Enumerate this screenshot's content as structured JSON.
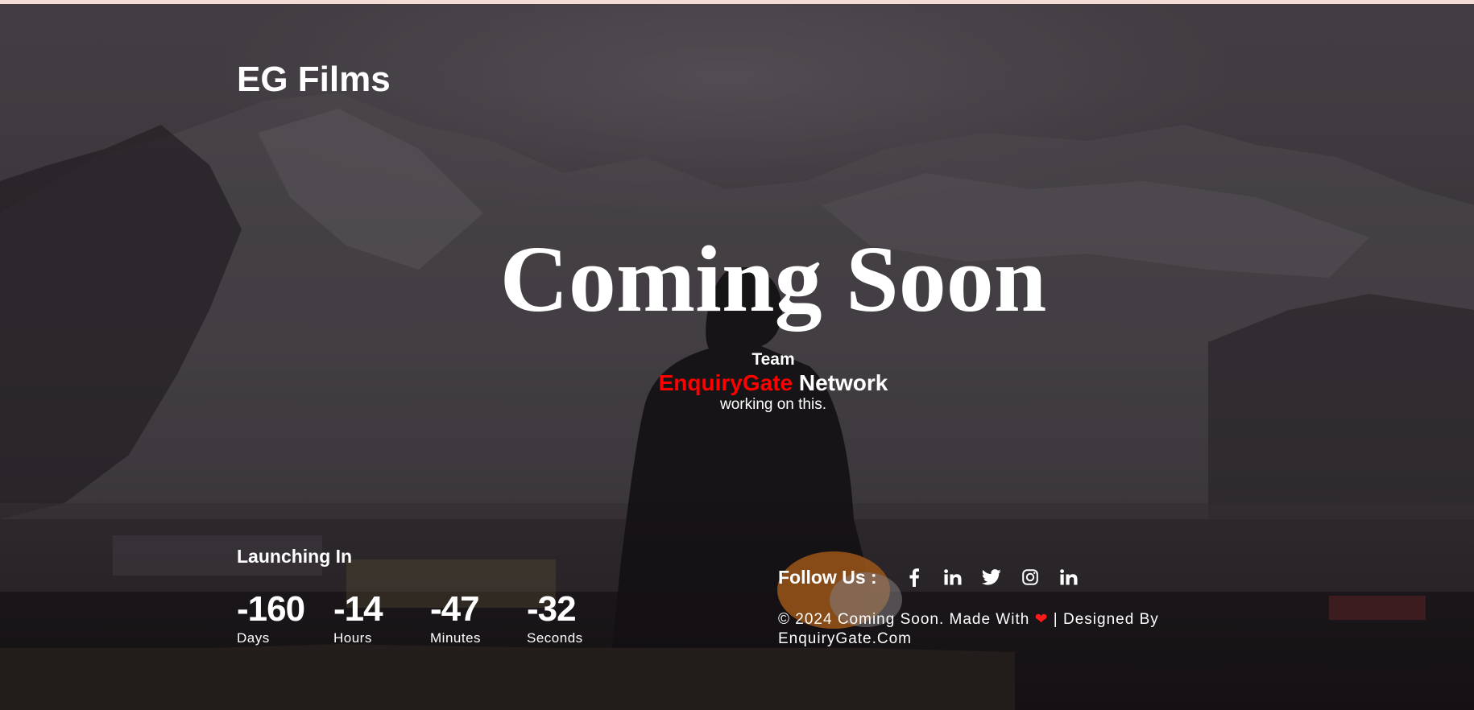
{
  "brand": {
    "logo_text": "EG Films"
  },
  "hero": {
    "title": "Coming Soon",
    "team_label": "Team",
    "team_brand": "EnquiryGate",
    "team_network": "Network",
    "team_note": "working on this."
  },
  "countdown": {
    "label": "Launching In",
    "items": [
      {
        "value": "-160",
        "unit": "Days"
      },
      {
        "value": "-14",
        "unit": "Hours"
      },
      {
        "value": "-47",
        "unit": "Minutes"
      },
      {
        "value": "-32",
        "unit": "Seconds"
      }
    ]
  },
  "footer": {
    "follow_label": "Follow Us :",
    "social_links": [
      {
        "name": "facebook",
        "icon": "facebook-icon"
      },
      {
        "name": "linkedin",
        "icon": "linkedin-icon"
      },
      {
        "name": "twitter",
        "icon": "twitter-icon"
      },
      {
        "name": "instagram",
        "icon": "instagram-icon"
      },
      {
        "name": "linkedin",
        "icon": "linkedin-icon"
      }
    ],
    "copyright_prefix": "© 2024 Coming Soon. Made With",
    "heart": "❤",
    "copyright_suffix": "| Designed By",
    "designer": "EnquiryGate.Com"
  },
  "colors": {
    "accent_red": "#ff0000",
    "text": "#ffffff",
    "top_strip": "#f2dcd3"
  }
}
